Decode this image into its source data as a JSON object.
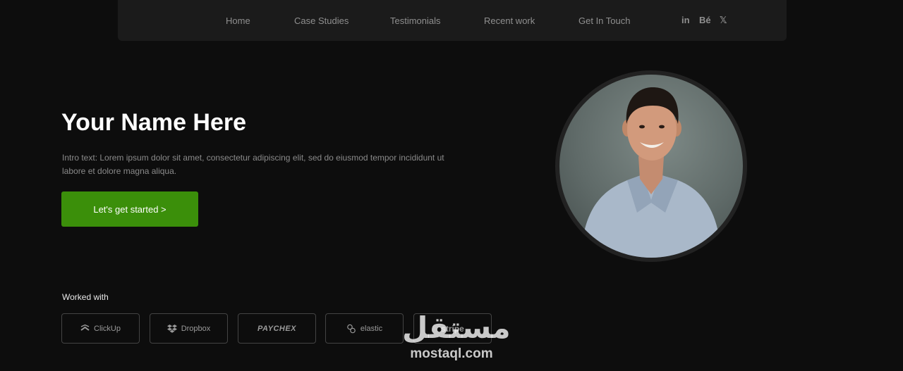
{
  "nav": {
    "links": [
      "Home",
      "Case Studies",
      "Testimonials",
      "Recent work",
      "Get In Touch"
    ],
    "social": [
      "in",
      "Bé",
      "𝕏"
    ]
  },
  "hero": {
    "title": "Your Name Here",
    "intro": "Intro text: Lorem ipsum dolor sit amet, consectetur adipiscing elit, sed do eiusmod tempor incididunt ut labore et dolore magna aliqua.",
    "cta_label": "Let's get started >"
  },
  "worked_with": {
    "label": "Worked with",
    "logos": [
      "ClickUp",
      "Dropbox",
      "PAYCHEX",
      "elastic",
      "stripe"
    ]
  },
  "watermark": {
    "arabic": "مستقل",
    "latin": "mostaql.com"
  },
  "colors": {
    "background": "#0d0d0d",
    "nav_background": "#1b1b1b",
    "accent": "#3b8f0a"
  }
}
